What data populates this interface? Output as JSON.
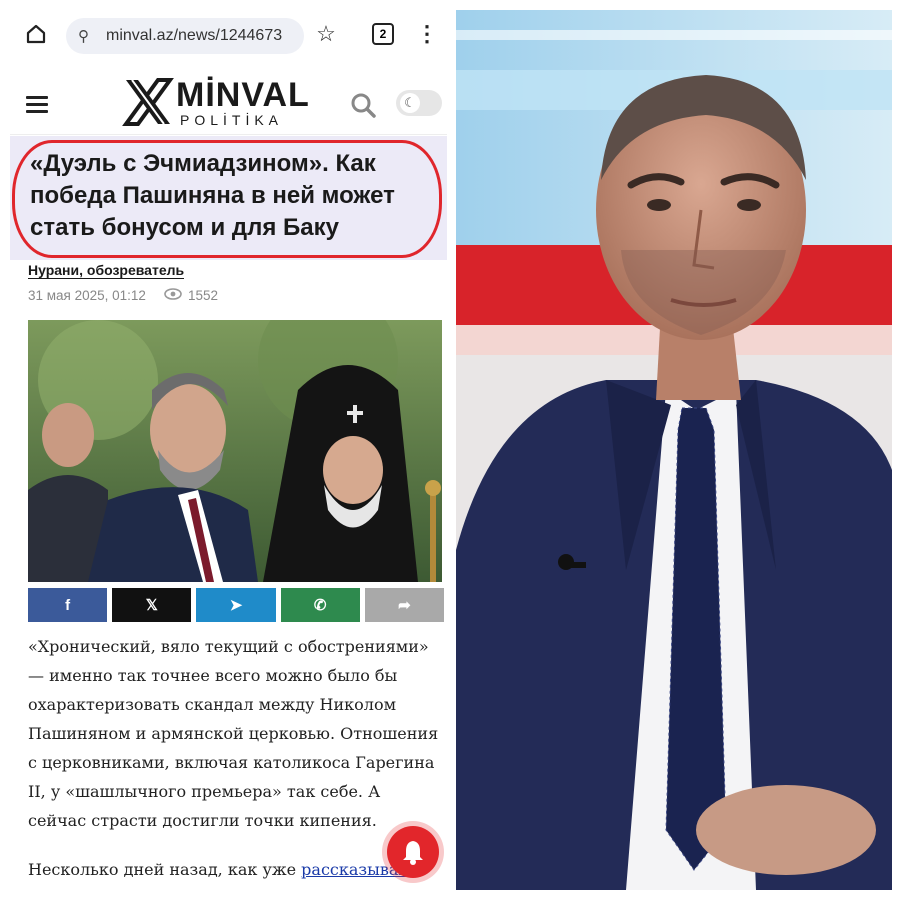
{
  "browser": {
    "url": "minval.az/news/1244673",
    "tab_count": "2",
    "icons": [
      "home-icon",
      "site-info-icon",
      "star-icon",
      "tabs-icon",
      "more-vert-icon"
    ]
  },
  "site": {
    "logo_word": "MİNVAL",
    "logo_sub": "POLİTİKA",
    "brand_color": "#1a1a1a"
  },
  "article": {
    "headline": "«Дуэль с Эчмиадзином». Как победа Пашиняна в ней может стать бонусом и для Баку",
    "author": "Нурани, обозреватель",
    "date": "31 мая 2025, 01:12",
    "views": "1552",
    "paragraph_1": "«Хронический, вяло текущий с обострениями» — именно так точнее всего можно было бы охарактеризовать скандал между Николом Пашиняном и армянской церковью. Отношения с церковниками, включая католикоса Гарегина II, у «шашлычного премьера» так себе. А сейчас страсти достигли точки кипения.",
    "paragraph_2_start": "Несколько дней назад, как уже ",
    "paragraph_2_link": "рассказывал"
  },
  "share": [
    {
      "name": "facebook",
      "icon": "f",
      "color": "#3b5a9a"
    },
    {
      "name": "x",
      "icon": "𝕏",
      "color": "#111111"
    },
    {
      "name": "telegram",
      "icon": "➤",
      "color": "#1f8bc9"
    },
    {
      "name": "whatsapp",
      "icon": "✆",
      "color": "#2e8a4e"
    },
    {
      "name": "share",
      "icon": "➦",
      "color": "#a9a9a9"
    }
  ],
  "colors": {
    "highlight_oval": "#e0262c",
    "headline_bg": "#eceaf7",
    "notify_button": "#e2262b"
  }
}
